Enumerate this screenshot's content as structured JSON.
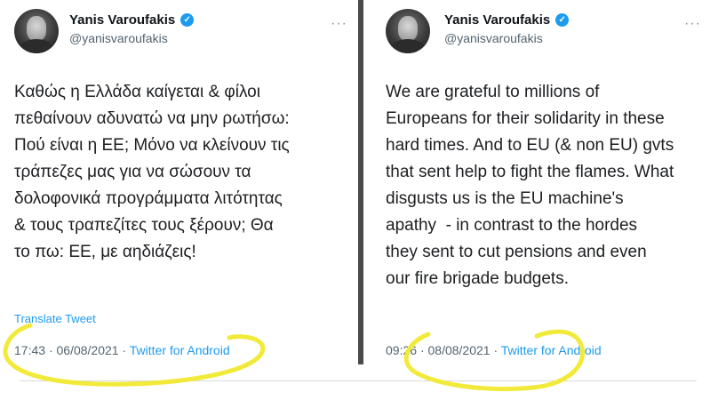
{
  "tweets": [
    {
      "author_name": "Yanis Varoufakis",
      "handle": "@yanisvaroufakis",
      "more_icon": "···",
      "text": "Καθώς η Ελλάδα καίγεται & φίλοι\nπεθαίνουν αδυνατώ να μην ρωτήσω:\nΠού είναι η ΕΕ; Μόνο να κλείνουν τις\nτράπεζες μας για να σώσουν τα\nδολοφονικά προγράμματα λιτότητας\n& τους τραπεζίτες τους ξέρουν; Θα\nτο πω: ΕΕ, με αηδιάζεις!",
      "translate_label": "Translate Tweet",
      "time": "17:43",
      "date": "06/08/2021",
      "app": "Twitter for Android"
    },
    {
      "author_name": "Yanis Varoufakis",
      "handle": "@yanisvaroufakis",
      "more_icon": "···",
      "text": "We are grateful to millions of\nEuropeans for their solidarity in these\nhard times. And to EU (& non EU) gvts\nthat sent help to fight the flames. What\ndisgusts us is the EU machine's\napathy  - in contrast to the hordes\nthey sent to cut pensions and even\nour fire brigade budgets.",
      "time": "09:26",
      "date": "08/08/2021",
      "app": "Twitter for Android"
    }
  ],
  "separator": "·",
  "highlight_color": "#f2ea3a",
  "verified_color": "#1d9bf0",
  "icons": {
    "verified": "verified-badge-icon",
    "more": "more-options-icon"
  }
}
